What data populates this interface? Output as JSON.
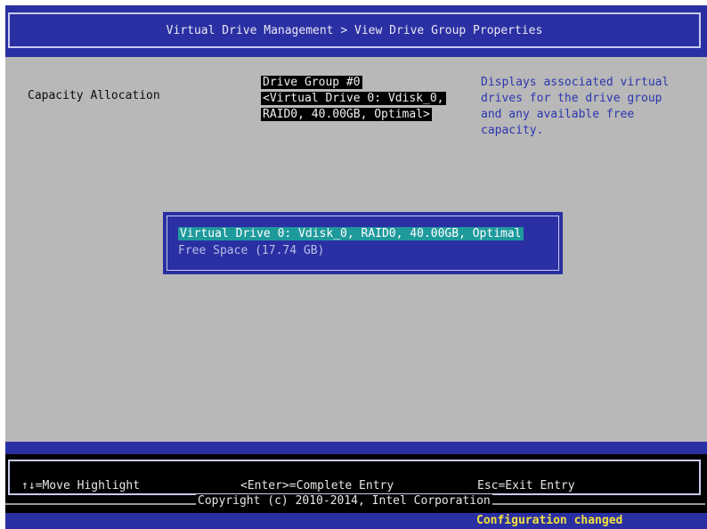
{
  "header": {
    "title": "Virtual Drive Management > View Drive Group Properties"
  },
  "field": {
    "label": "Capacity Allocation",
    "value_lines": [
      "Drive Group #0",
      "<Virtual Drive 0: Vdisk_0,",
      "RAID0, 40.00GB, Optimal>"
    ]
  },
  "help": {
    "text": "Displays associated virtual\ndrives for the drive group\nand any available free\ncapacity."
  },
  "popup": {
    "options": [
      "Virtual Drive 0: Vdisk_0, RAID0, 40.00GB, Optimal",
      "Free Space (17.74 GB)"
    ]
  },
  "footer": {
    "keys": [
      "↑↓=Move Highlight",
      "<Enter>=Complete Entry",
      "Esc=Exit Entry"
    ],
    "copyright": "Copyright (c) 2010-2014, Intel Corporation",
    "status": "Configuration changed"
  },
  "colors": {
    "bios_blue": "#2a2fa3",
    "body_gray": "#b8b8b8",
    "help_text": "#2c36b0",
    "selection": "#1f9a9c",
    "status_yellow": "#f2e23c"
  }
}
